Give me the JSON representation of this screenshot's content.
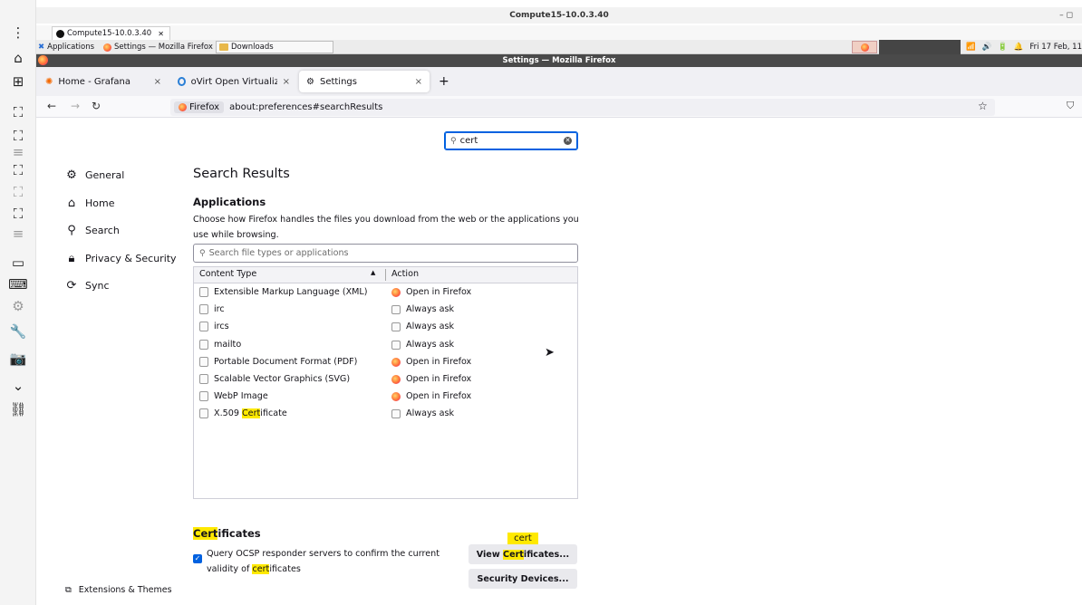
{
  "outer": {
    "title": "Compute15-10.0.3.40",
    "window_controls": "–  ◻",
    "session_tab": "Compute15-10.0.3.40",
    "session_tab_close": "✕"
  },
  "taskbar": {
    "applications": "Applications",
    "settings_item": "Settings — Mozilla Firefox",
    "downloads_item": "Downloads",
    "clock": "Fri 17 Feb, 11"
  },
  "firefox": {
    "window_title": "Settings — Mozilla Firefox",
    "tabs": [
      {
        "label": "Home - Grafana",
        "close": "×"
      },
      {
        "label": "oVirt Open Virtualization",
        "close": "×"
      },
      {
        "label": "Settings",
        "close": "×"
      }
    ],
    "new_tab": "+",
    "url_identity": "Firefox",
    "url": "about:preferences#searchResults"
  },
  "settings": {
    "search_value": "cert",
    "categories": [
      "General",
      "Home",
      "Search",
      "Privacy & Security",
      "Sync"
    ],
    "results_heading": "Search Results",
    "apps_heading": "Applications",
    "apps_desc": "Choose how Firefox handles the files you download from the web or the applications you use while browsing.",
    "filter_placeholder": "Search file types or applications",
    "col_content_type": "Content Type",
    "col_action": "Action",
    "rows": [
      {
        "type": "Extensible Markup Language (XML)",
        "action": "Open in Firefox",
        "action_kind": "firefox"
      },
      {
        "type": "irc",
        "action": "Always ask",
        "action_kind": "ask"
      },
      {
        "type": "ircs",
        "action": "Always ask",
        "action_kind": "ask"
      },
      {
        "type": "mailto",
        "action": "Always ask",
        "action_kind": "ask"
      },
      {
        "type": "Portable Document Format (PDF)",
        "action": "Open in Firefox",
        "action_kind": "firefox"
      },
      {
        "type": "Scalable Vector Graphics (SVG)",
        "action": "Open in Firefox",
        "action_kind": "firefox"
      },
      {
        "type": "WebP Image",
        "action": "Open in Firefox",
        "action_kind": "firefox"
      }
    ],
    "last_row": {
      "pre": "X.509 ",
      "hl": "Cert",
      "post": "ificate",
      "action": "Always ask"
    },
    "certs_heading_hl": "Cert",
    "certs_heading_rest": "ificates",
    "ocsp_pre": "Query OCSP responder servers to confirm the current validity of ",
    "ocsp_hl": "cert",
    "ocsp_post": "ificates",
    "tooltip": "cert",
    "view_certs_pre": "View ",
    "view_certs_hl": "Cert",
    "view_certs_post": "ificates...",
    "security_devices": "Security Devices...",
    "extensions_themes": "Extensions & Themes"
  }
}
